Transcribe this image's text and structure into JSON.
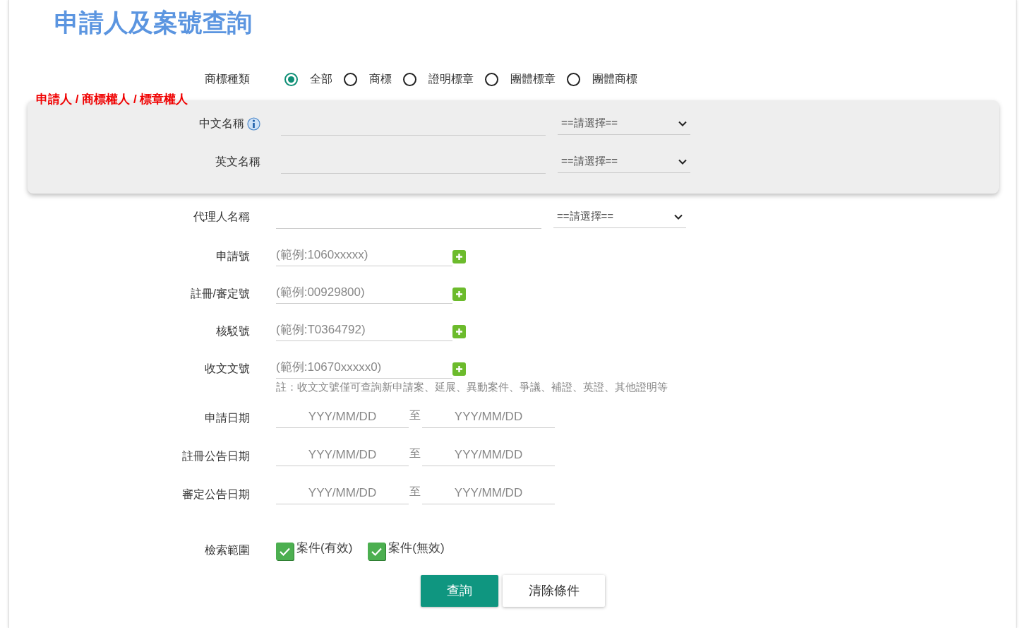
{
  "title": "申請人及案號查詢",
  "trademark_type": {
    "label": "商標種類",
    "options": [
      {
        "label": "全部",
        "selected": true
      },
      {
        "label": "商標",
        "selected": false
      },
      {
        "label": "證明標章",
        "selected": false
      },
      {
        "label": "團體標章",
        "selected": false
      },
      {
        "label": "團體商標",
        "selected": false
      }
    ]
  },
  "applicant": {
    "heading": "申請人 / 商標權人 / 標章權人",
    "fields": [
      {
        "label": "中文名稱",
        "info": true,
        "select": "==請選擇=="
      },
      {
        "label": "英文名稱",
        "info": false,
        "select": "==請選擇=="
      }
    ]
  },
  "agent": {
    "label": "代理人名稱",
    "select": "==請選擇=="
  },
  "number_fields": [
    {
      "label": "申請號",
      "placeholder": "(範例:1060xxxxx)"
    },
    {
      "label": "註冊/審定號",
      "placeholder": "(範例:00929800)"
    },
    {
      "label": "核駁號",
      "placeholder": "(範例:T0364792)"
    },
    {
      "label": "收文文號",
      "placeholder": "(範例:10670xxxxx0)"
    }
  ],
  "note": "註：收文文號僅可查詢新申請案、延展、異動案件、爭議、補證、英證、其他證明等",
  "date_fields": [
    {
      "label": "申請日期",
      "from_placeholder": "YYY/MM/DD",
      "separator": "至",
      "to_placeholder": "YYY/MM/DD"
    },
    {
      "label": "註冊公告日期",
      "from_placeholder": "YYY/MM/DD",
      "separator": "至",
      "to_placeholder": "YYY/MM/DD"
    },
    {
      "label": "審定公告日期",
      "from_placeholder": "YYY/MM/DD",
      "separator": "至",
      "to_placeholder": "YYY/MM/DD"
    }
  ],
  "scope": {
    "label": "檢索範圍",
    "options": [
      {
        "label": "案件(有效)",
        "checked": true
      },
      {
        "label": "案件(無效)",
        "checked": true
      }
    ]
  },
  "buttons": [
    {
      "label": "查詢",
      "kind": "primary"
    },
    {
      "label": "清除條件",
      "kind": "secondary"
    }
  ]
}
